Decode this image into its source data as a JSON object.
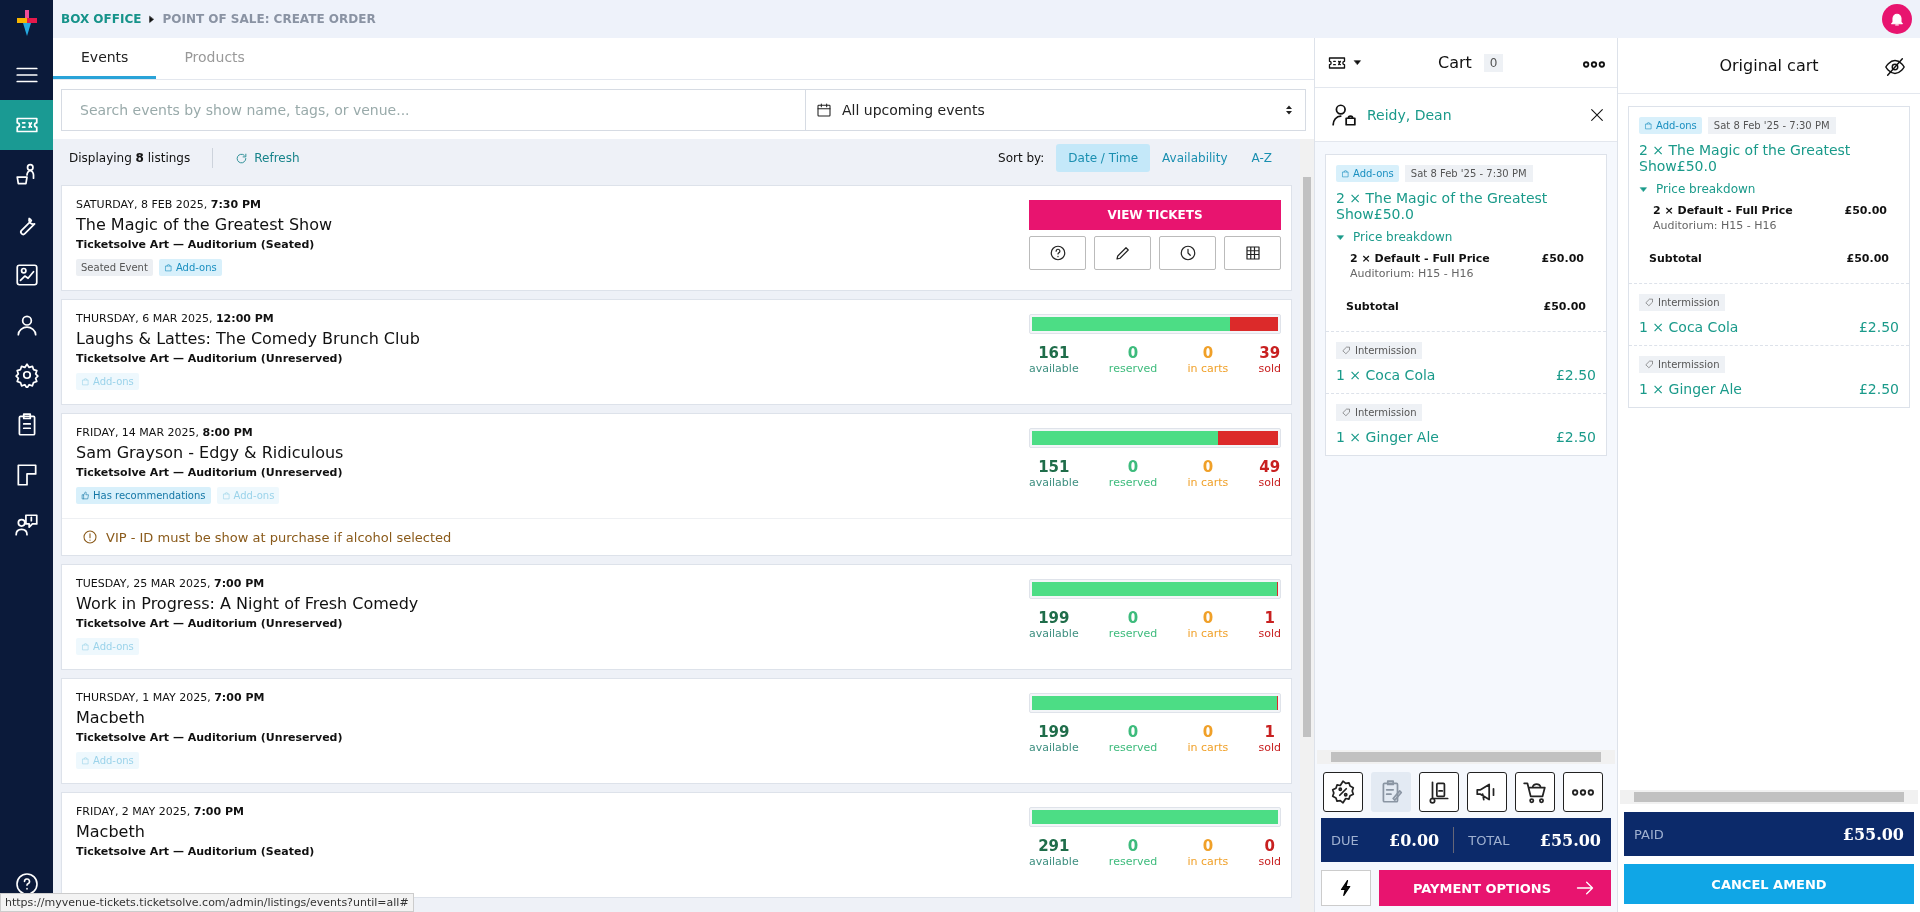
{
  "breadcrumb": {
    "section": "BOX OFFICE",
    "page": "POINT OF SALE: CREATE ORDER"
  },
  "sidebar": {
    "items": [
      {
        "kind": "menu",
        "selected": false
      },
      {
        "kind": "ticket",
        "selected": true
      },
      {
        "kind": "people",
        "selected": false
      },
      {
        "kind": "wrench",
        "selected": false
      },
      {
        "kind": "report",
        "selected": false
      },
      {
        "kind": "person",
        "selected": false
      },
      {
        "kind": "gear",
        "selected": false
      },
      {
        "kind": "clipboard",
        "selected": false
      },
      {
        "kind": "layout",
        "selected": false
      },
      {
        "kind": "support",
        "selected": false
      }
    ]
  },
  "tabs": [
    {
      "label": "Events",
      "selected": true
    },
    {
      "label": "Products",
      "selected": false
    }
  ],
  "search": {
    "placeholder": "Search events by show name, tags, or venue..."
  },
  "date_filter": {
    "value": "All upcoming events"
  },
  "toolbar": {
    "count": "Displaying **8** listings",
    "refresh": "Refresh",
    "sort_label": "Sort by:",
    "sort_options": [
      {
        "label": "Date / Time",
        "selected": true
      },
      {
        "label": "Availability",
        "selected": false
      },
      {
        "label": "A-Z",
        "selected": false
      }
    ]
  },
  "events": [
    {
      "kind": "actions",
      "date": "SATURDAY, 8 FEB 2025,",
      "time": "7:30 PM",
      "title": "The Magic of the Greatest Show",
      "venue": "Ticketsolve Art — Auditorium (Seated)",
      "tags": [
        {
          "kind": "seated",
          "label": "Seated Event",
          "disabled": false
        },
        {
          "kind": "addons",
          "label": "Add-ons",
          "disabled": false
        }
      ],
      "button": "VIEW TICKETS"
    },
    {
      "kind": "stats",
      "date": "THURSDAY, 6 MAR 2025,",
      "time": "12:00 PM",
      "title": "Laughs & Lattes: The Comedy Brunch Club",
      "venue": "Ticketsolve Art — Auditorium (Unreserved)",
      "tags": [
        {
          "kind": "addons",
          "label": "Add-ons",
          "disabled": true
        }
      ],
      "level": 0.805,
      "stats": [
        {
          "kind": "available",
          "value": "161",
          "label": "available"
        },
        {
          "kind": "reserved",
          "value": "0",
          "label": "reserved"
        },
        {
          "kind": "carts",
          "value": "0",
          "label": "in carts"
        },
        {
          "kind": "sold",
          "value": "39",
          "label": "sold"
        }
      ]
    },
    {
      "kind": "stats",
      "date": "FRIDAY, 14 MAR 2025,",
      "time": "8:00 PM",
      "title": "Sam Grayson - Edgy & Ridiculous",
      "venue": "Ticketsolve Art — Auditorium (Unreserved)",
      "tags": [
        {
          "kind": "recommendations",
          "label": "Has recommendations",
          "disabled": false
        },
        {
          "kind": "addons",
          "label": "Add-ons",
          "disabled": true
        }
      ],
      "level": 0.755,
      "stats": [
        {
          "kind": "available",
          "value": "151",
          "label": "available"
        },
        {
          "kind": "reserved",
          "value": "0",
          "label": "reserved"
        },
        {
          "kind": "carts",
          "value": "0",
          "label": "in carts"
        },
        {
          "kind": "sold",
          "value": "49",
          "label": "sold"
        }
      ],
      "notice": "VIP - ID must be show at purchase if alcohol selected"
    },
    {
      "kind": "stats",
      "date": "TUESDAY, 25 MAR 2025,",
      "time": "7:00 PM",
      "title": "Work in Progress: A Night of Fresh Comedy",
      "venue": "Ticketsolve Art — Auditorium (Unreserved)",
      "tags": [
        {
          "kind": "addons",
          "label": "Add-ons",
          "disabled": true
        }
      ],
      "level": 0.995,
      "stats": [
        {
          "kind": "available",
          "value": "199",
          "label": "available"
        },
        {
          "kind": "reserved",
          "value": "0",
          "label": "reserved"
        },
        {
          "kind": "carts",
          "value": "0",
          "label": "in carts"
        },
        {
          "kind": "sold",
          "value": "1",
          "label": "sold"
        }
      ]
    },
    {
      "kind": "stats",
      "date": "THURSDAY, 1 MAY 2025,",
      "time": "7:00 PM",
      "title": "Macbeth",
      "venue": "Ticketsolve Art — Auditorium (Unreserved)",
      "tags": [
        {
          "kind": "addons",
          "label": "Add-ons",
          "disabled": true
        }
      ],
      "level": 0.995,
      "stats": [
        {
          "kind": "available",
          "value": "199",
          "label": "available"
        },
        {
          "kind": "reserved",
          "value": "0",
          "label": "reserved"
        },
        {
          "kind": "carts",
          "value": "0",
          "label": "in carts"
        },
        {
          "kind": "sold",
          "value": "1",
          "label": "sold"
        }
      ]
    },
    {
      "kind": "stats",
      "date": "FRIDAY, 2 MAY 2025,",
      "time": "7:00 PM",
      "title": "Macbeth",
      "venue": "Ticketsolve Art — Auditorium (Seated)",
      "level": 1,
      "stats": [
        {
          "kind": "available",
          "value": "291",
          "label": "available"
        },
        {
          "kind": "reserved",
          "value": "0",
          "label": "reserved"
        },
        {
          "kind": "carts",
          "value": "0",
          "label": "in carts"
        },
        {
          "kind": "sold",
          "value": "0",
          "label": "sold"
        }
      ]
    }
  ],
  "status_bar": "https://myvenue-tickets.ticketsolve.com/admin/listings/events?until=all#",
  "cart": {
    "title": "Cart",
    "count": "0",
    "customer": "Reidy, Dean",
    "order": {
      "tag": "Add-ons",
      "date": "Sat 8 Feb '25 - 7:30 PM",
      "title": "2 × The Magic of the Greatest Show",
      "price": "£50.0",
      "breakdown_label": "Price breakdown",
      "expanded": true,
      "line": "2 × Default - Full Price",
      "line_price": "£50.00",
      "seats": "Auditorium: H15 - H16",
      "subtotal_label": "Subtotal",
      "subtotal": "£50.00",
      "addons": [
        {
          "tag": "Intermission",
          "name": "1 × Coca Cola",
          "price": "£2.50"
        },
        {
          "tag": "Intermission",
          "name": "1 × Ginger Ale",
          "price": "£2.50"
        }
      ]
    },
    "tools": [
      {
        "kind": "discount",
        "selected": false
      },
      {
        "kind": "notes",
        "selected": true
      },
      {
        "kind": "trolley",
        "selected": false
      },
      {
        "kind": "megaphone",
        "selected": false
      },
      {
        "kind": "cart",
        "selected": false
      },
      {
        "kind": "more",
        "selected": false
      }
    ],
    "due_label": "DUE",
    "due": "£0.00",
    "total_label": "TOTAL",
    "total": "£55.00",
    "payment": "PAYMENT OPTIONS"
  },
  "original_cart": {
    "title": "Original cart",
    "order": {
      "tag": "Add-ons",
      "date": "Sat 8 Feb '25 - 7:30 PM",
      "title": "2 × The Magic of the Greatest Show",
      "price": "£50.0",
      "breakdown_label": "Price breakdown",
      "expanded": true,
      "line": "2 × Default - Full Price",
      "line_price": "£50.00",
      "seats": "Auditorium: H15 - H16",
      "subtotal_label": "Subtotal",
      "subtotal": "£50.00",
      "addons": [
        {
          "tag": "Intermission",
          "name": "1 × Coca Cola",
          "price": "£2.50"
        },
        {
          "tag": "Intermission",
          "name": "1 × Ginger Ale",
          "price": "£2.50"
        }
      ]
    },
    "paid_label": "PAID",
    "paid": "£55.00",
    "cancel": "CANCEL AMEND"
  }
}
